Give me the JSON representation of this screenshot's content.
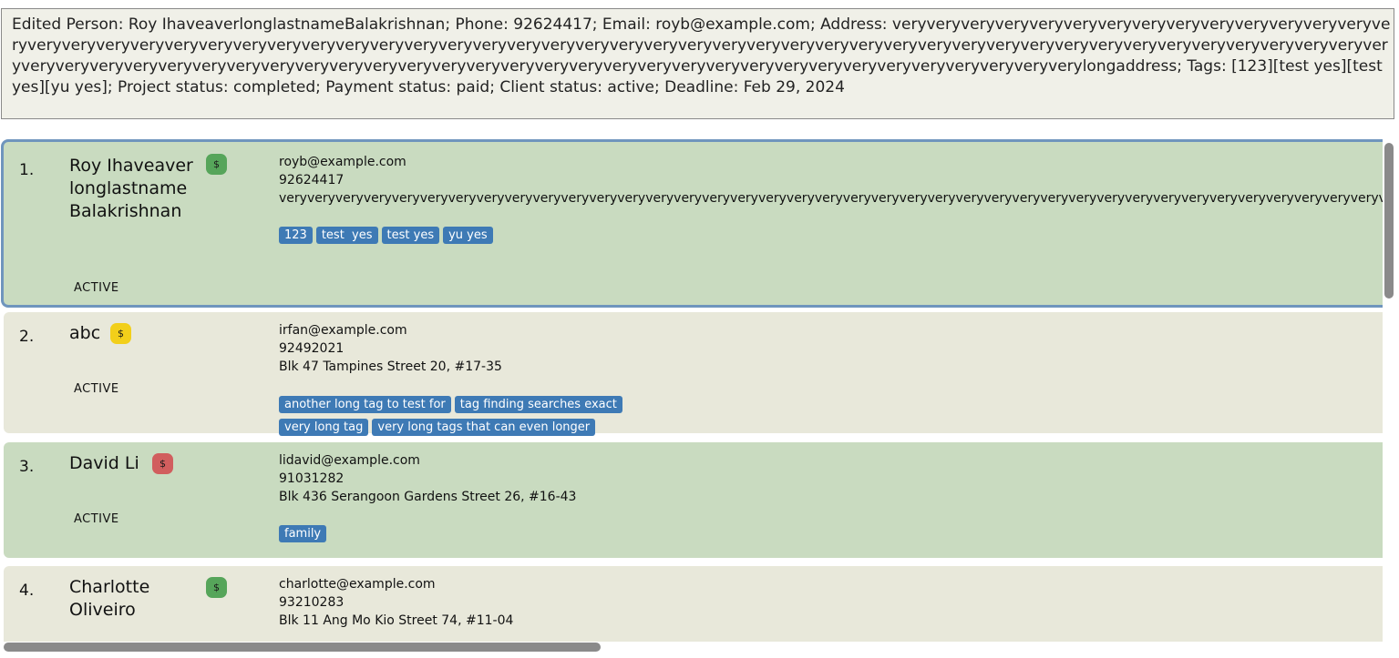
{
  "result": {
    "text": "Edited Person: Roy IhaveaverlonglastnameBalakrishnan; Phone: 92624417; Email: royb@example.com; Address: veryveryveryveryveryveryveryveryveryveryveryveryveryveryveryveryveryveryveryveryveryveryveryveryveryveryveryveryveryveryveryveryveryveryveryveryveryveryveryveryveryveryveryveryveryveryveryveryveryveryveryveryveryveryveryveryveryveryveryveryveryveryveryveryveryveryveryveryveryveryveryveryveryveryveryveryveryveryveryveryveryveryveryveryveryverylongaddress; Tags: [123][test  yes][test yes][yu yes]; Project status: completed; Payment status: paid; Client status: active; Deadline: Feb 29, 2024"
  },
  "persons": [
    {
      "index": "1.",
      "name": "Roy IhaveaverlonglastnameBalakrishnan",
      "payment_icon": "$",
      "payment_color": "#56a55a",
      "status": "ACTIVE",
      "email": "royb@example.com",
      "phone": "92624417",
      "address": "veryveryveryveryveryveryveryveryveryveryveryveryveryveryveryveryveryveryveryveryveryveryveryveryveryveryveryveryveryveryveryveryveryveryveryveryveryveryveryveryveryveryveryveryveryveryveryveryveryveryveryveryveryveryveryveryveryveryveryveryveryveryveryveryveryveryveryveryveryveryveryveryveryveryveryveryveryveryveryveryveryveryveryveryveryverylongaddress",
      "tags": [
        "123",
        "test  yes",
        "test yes",
        "yu yes"
      ]
    },
    {
      "index": "2.",
      "name": "abc",
      "payment_icon": "$",
      "payment_color": "#f2cf1a",
      "status": "ACTIVE",
      "email": "irfan@example.com",
      "phone": "92492021",
      "address": "Blk 47 Tampines Street 20, #17-35",
      "tags": [
        "another long tag to test for",
        "tag finding searches exact",
        "very long tag",
        "very long tags that can even longer"
      ]
    },
    {
      "index": "3.",
      "name": "David Li",
      "payment_icon": "$",
      "payment_color": "#d15e5e",
      "status": "ACTIVE",
      "email": "lidavid@example.com",
      "phone": "91031282",
      "address": "Blk 436 Serangoon Gardens Street 26, #16-43",
      "tags": [
        "family"
      ]
    },
    {
      "index": "4.",
      "name": "Charlotte Oliveiro",
      "payment_icon": "$",
      "payment_color": "#56a55a",
      "email": "charlotte@example.com",
      "phone": "93210283",
      "address": "Blk 11 Ang Mo Kio Street 74, #11-04"
    }
  ]
}
